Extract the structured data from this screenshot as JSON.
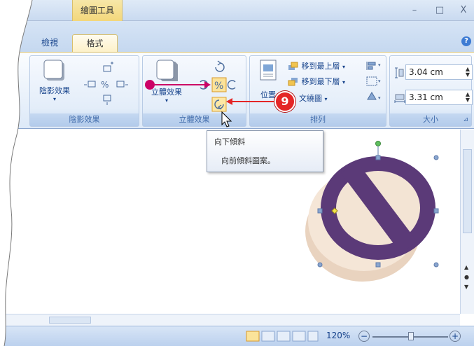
{
  "title_bar": {
    "context_tab_group": "繪圖工具",
    "minimize": "–",
    "maximize": "□",
    "close": "X"
  },
  "tabs": {
    "view": "檢視",
    "format": "格式",
    "help": "?"
  },
  "ribbon": {
    "shadow_group": {
      "label": "陰影效果",
      "button": "陰影效果",
      "dropdown": "▾"
    },
    "threed_group": {
      "label": "立體效果",
      "button": "立體效果",
      "dropdown": "▾"
    },
    "arrange_group": {
      "label": "排列",
      "position": "位置",
      "bring_front": "移到最上層",
      "send_back": "移到最下層",
      "text_wrap": "文繞圖",
      "dropdown": "▾"
    },
    "size_group": {
      "label": "大小",
      "height": "3.04 cm",
      "width": "3.31 cm",
      "launcher": "⊿"
    }
  },
  "tooltip": {
    "title": "向下傾斜",
    "description": "向前傾斜圖案。"
  },
  "callout": {
    "number": "9"
  },
  "status": {
    "zoom": "120%",
    "zoom_out": "−",
    "zoom_in": "+"
  },
  "colors": {
    "callout_red": "#e42626",
    "arrow_magenta": "#cc0066",
    "shape_purple": "#5b3a78",
    "shape_cream": "#f3e2d0"
  }
}
